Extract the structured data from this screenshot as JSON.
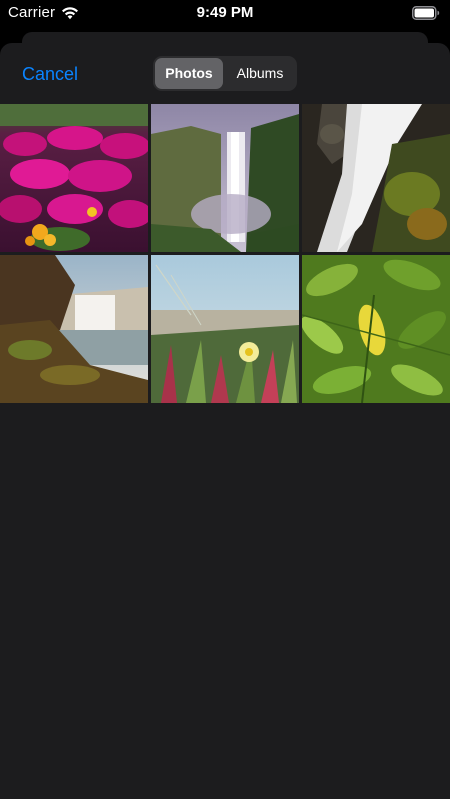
{
  "status_bar": {
    "carrier": "Carrier",
    "time": "9:49 PM",
    "wifi_icon": "wifi-icon",
    "battery_icon": "battery-full-icon"
  },
  "nav": {
    "cancel_label": "Cancel",
    "segments": [
      {
        "label": "Photos",
        "selected": true
      },
      {
        "label": "Albums",
        "selected": false
      }
    ]
  },
  "photos": [
    {
      "subject": "pink flowers",
      "selected": false
    },
    {
      "subject": "waterfall in valley",
      "selected": false
    },
    {
      "subject": "waterfall over mossy rock",
      "selected": false
    },
    {
      "subject": "waterfall at rocky shore",
      "selected": false
    },
    {
      "subject": "beach grass and yellow flower",
      "selected": false
    },
    {
      "subject": "green leaves",
      "selected": false
    }
  ],
  "colors": {
    "accent": "#0a84ff",
    "sheet_background": "#1c1c1e",
    "segment_track": "#2c2c2e",
    "segment_selected": "#636366"
  }
}
